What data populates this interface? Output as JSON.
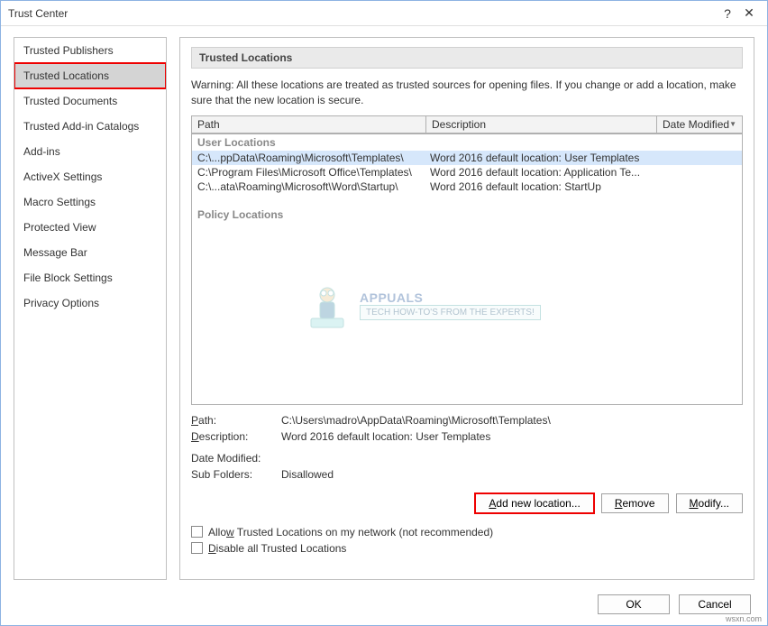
{
  "titlebar": {
    "title": "Trust Center",
    "help": "?",
    "close": "✕"
  },
  "sidebar": {
    "items": [
      {
        "label": "Trusted Publishers",
        "selected": false
      },
      {
        "label": "Trusted Locations",
        "selected": true
      },
      {
        "label": "Trusted Documents",
        "selected": false
      },
      {
        "label": "Trusted Add-in Catalogs",
        "selected": false
      },
      {
        "label": "Add-ins",
        "selected": false
      },
      {
        "label": "ActiveX Settings",
        "selected": false
      },
      {
        "label": "Macro Settings",
        "selected": false
      },
      {
        "label": "Protected View",
        "selected": false
      },
      {
        "label": "Message Bar",
        "selected": false
      },
      {
        "label": "File Block Settings",
        "selected": false
      },
      {
        "label": "Privacy Options",
        "selected": false
      }
    ]
  },
  "main": {
    "section_title": "Trusted Locations",
    "warning": "Warning: All these locations are treated as trusted sources for opening files.  If you change or add a location, make sure that the new location is secure.",
    "columns": {
      "path": "Path",
      "description": "Description",
      "date": "Date Modified"
    },
    "groups": {
      "user": "User Locations",
      "policy": "Policy Locations"
    },
    "rows": [
      {
        "path": "C:\\...ppData\\Roaming\\Microsoft\\Templates\\",
        "desc": "Word 2016 default location: User Templates",
        "selected": true
      },
      {
        "path": "C:\\Program Files\\Microsoft Office\\Templates\\",
        "desc": "Word 2016 default location: Application Te...",
        "selected": false
      },
      {
        "path": "C:\\...ata\\Roaming\\Microsoft\\Word\\Startup\\",
        "desc": "Word 2016 default location: StartUp",
        "selected": false
      }
    ],
    "details": {
      "path_label": "ath:",
      "path_prefix": "P",
      "desc_label": "escription:",
      "desc_prefix": "D",
      "date_label": "Date Modified:",
      "sub_label": "Sub Folders:",
      "path_value": "C:\\Users\\madro\\AppData\\Roaming\\Microsoft\\Templates\\",
      "desc_value": "Word 2016 default location: User Templates",
      "date_value": "",
      "sub_value": "Disallowed"
    },
    "buttons": {
      "add_prefix": "A",
      "add_rest": "dd new location...",
      "remove_prefix": "R",
      "remove_rest": "emove",
      "modify_prefix": "M",
      "modify_rest": "odify..."
    },
    "checkboxes": {
      "allow_prefix": "w",
      "allow_text_before": "Allo",
      "allow_text_after": " Trusted Locations on my network (not recommended)",
      "disable_prefix": "D",
      "disable_rest": "isable all Trusted Locations"
    }
  },
  "footer": {
    "ok": "OK",
    "cancel": "Cancel"
  },
  "watermark": {
    "brand": "APPUALS",
    "tag": "TECH HOW-TO'S FROM THE EXPERTS!"
  },
  "attribution": "wsxn.com"
}
